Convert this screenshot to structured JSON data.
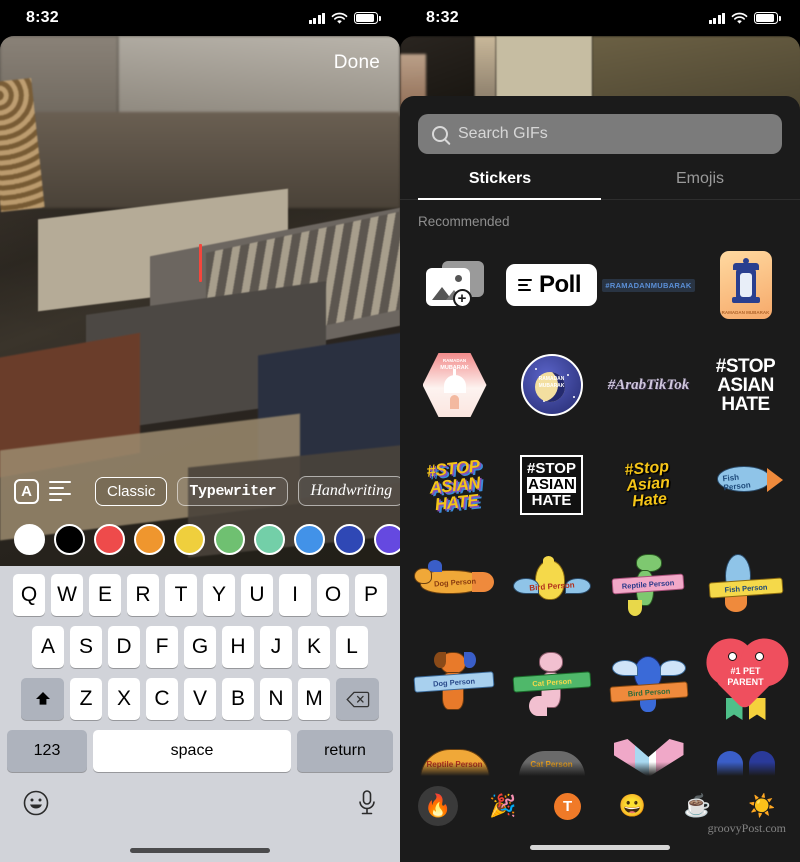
{
  "status_bar": {
    "time": "8:32",
    "icons": [
      "cellular-signal",
      "wifi",
      "battery"
    ]
  },
  "left_panel": {
    "done_label": "Done",
    "text_cursor_color": "#f5463c",
    "toolbar": {
      "style_icon": "A",
      "align_icon": "text-align-icon",
      "fonts": [
        {
          "label": "Classic",
          "selected": true
        },
        {
          "label": "Typewriter",
          "selected": false
        },
        {
          "label": "Handwriting",
          "selected": false
        }
      ]
    },
    "colors": [
      {
        "name": "white",
        "hex": "#ffffff"
      },
      {
        "name": "black",
        "hex": "#000000"
      },
      {
        "name": "red",
        "hex": "#ee4b4b"
      },
      {
        "name": "orange",
        "hex": "#ef962e"
      },
      {
        "name": "yellow",
        "hex": "#efcf3d"
      },
      {
        "name": "green",
        "hex": "#6fc071"
      },
      {
        "name": "mint",
        "hex": "#73cfa8"
      },
      {
        "name": "blue",
        "hex": "#4292e8"
      },
      {
        "name": "navy",
        "hex": "#2f48b5"
      },
      {
        "name": "purple",
        "hex": "#6549e0"
      }
    ],
    "keyboard": {
      "row1": [
        "Q",
        "W",
        "E",
        "R",
        "T",
        "Y",
        "U",
        "I",
        "O",
        "P"
      ],
      "row2": [
        "A",
        "S",
        "D",
        "F",
        "G",
        "H",
        "J",
        "K",
        "L"
      ],
      "row3": [
        "Z",
        "X",
        "C",
        "V",
        "B",
        "N",
        "M"
      ],
      "shift_icon": "shift-arrow-icon",
      "backspace_icon": "backspace-icon",
      "numbers_label": "123",
      "space_label": "space",
      "return_label": "return",
      "emoji_icon": "emoji-face-icon",
      "dictation_icon": "microphone-icon"
    }
  },
  "right_panel": {
    "search": {
      "placeholder": "Search GIFs",
      "icon": "search-icon"
    },
    "tabs": [
      {
        "label": "Stickers",
        "active": true
      },
      {
        "label": "Emojis",
        "active": false
      }
    ],
    "section_title": "Recommended",
    "stickers": [
      {
        "name": "add-photo-sticker",
        "text": ""
      },
      {
        "name": "poll-sticker",
        "text": "Poll"
      },
      {
        "name": "ramadan-mubarak-text",
        "text": "#RAMADANMUBARAK"
      },
      {
        "name": "ramadan-lantern-sticker",
        "text": "RAMADAN MUBARAK"
      },
      {
        "name": "ramadan-mosque-hexagon",
        "text": "RAMADAN MUBARAK"
      },
      {
        "name": "ramadan-moon-circle",
        "text": "RAMADAN MUBARAK"
      },
      {
        "name": "arab-tiktok-sticker",
        "text": "#ArabTikTok"
      },
      {
        "name": "stop-asian-hate-plain",
        "text": "#STOP ASIAN HATE"
      },
      {
        "name": "stop-asian-hate-yellow",
        "text": "#STOP ASIAN HATE"
      },
      {
        "name": "stop-asian-hate-box",
        "text": "#STOP ASIAN HATE"
      },
      {
        "name": "stop-asian-hate-script",
        "text": "#Stop Asian Hate"
      },
      {
        "name": "fish-person-blue",
        "text": "Fish Person"
      },
      {
        "name": "dog-person-orange",
        "text": "Dog Person"
      },
      {
        "name": "bird-person-yellow",
        "text": "Bird Person"
      },
      {
        "name": "reptile-person-green",
        "text": "Reptile Person"
      },
      {
        "name": "fish-person-yellow",
        "text": "Fish Person"
      },
      {
        "name": "dog-person-banner",
        "text": "Dog Person"
      },
      {
        "name": "cat-person-banner",
        "text": "Cat Person"
      },
      {
        "name": "bird-person-banner",
        "text": "Bird Person"
      },
      {
        "name": "pet-parent-heart",
        "text": "#1 PET PARENT"
      },
      {
        "name": "reptile-person-partial",
        "text": "Reptile Person"
      },
      {
        "name": "cat-person-partial",
        "text": "Cat Person"
      },
      {
        "name": "trans-flag-partial",
        "text": ""
      },
      {
        "name": "fish-partial",
        "text": ""
      }
    ],
    "category_bar": [
      {
        "name": "fire-emoji-tab",
        "glyph": "🔥",
        "selected": true
      },
      {
        "name": "party-emoji-tab",
        "glyph": "🎉",
        "selected": false
      },
      {
        "name": "text-sticker-tab",
        "glyph": "T",
        "selected": false
      },
      {
        "name": "smiley-emoji-tab",
        "glyph": "😀",
        "selected": false
      },
      {
        "name": "coffee-emoji-tab",
        "glyph": "☕",
        "selected": false
      },
      {
        "name": "sun-emoji-tab",
        "glyph": "☀️",
        "selected": false
      }
    ],
    "watermark": "groovyPost.com"
  }
}
